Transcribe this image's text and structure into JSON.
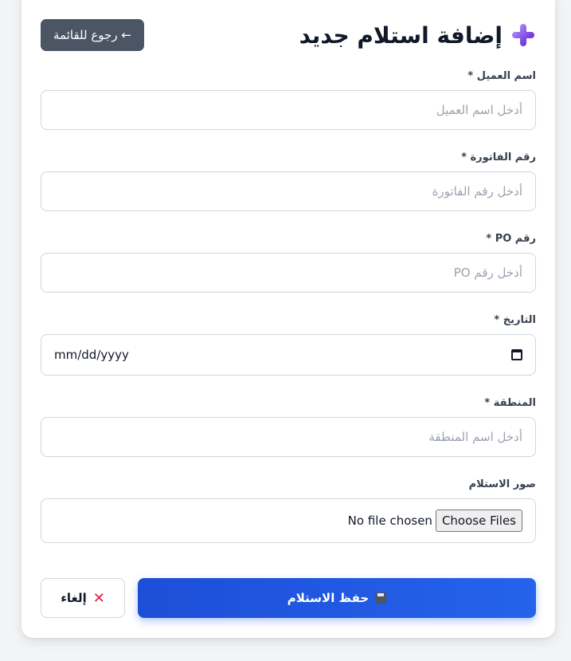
{
  "header": {
    "title": "إضافة استلام جديد",
    "back_label": "← رجوع للقائمة"
  },
  "form": {
    "customer": {
      "label": "اسم العميل *",
      "placeholder": "أدخل اسم العميل"
    },
    "invoice": {
      "label": "رقم الفاتورة *",
      "placeholder": "أدخل رقم الفاتورة"
    },
    "po": {
      "label": "رقم PO *",
      "placeholder": "أدخل رقم PO"
    },
    "date": {
      "label": "التاريخ *",
      "value": "mm/dd/yyyy"
    },
    "region": {
      "label": "المنطقة *",
      "placeholder": "أدخل اسم المنطقة"
    },
    "photos": {
      "label": "صور الاستلام",
      "button": "Choose Files",
      "status": "No file chosen"
    }
  },
  "actions": {
    "save_label": "حفظ الاستلام",
    "cancel_label": "إلغاء"
  },
  "colors": {
    "primary": "#2563eb",
    "back_button": "#4b5563",
    "cancel_icon": "#e11d48"
  },
  "icons": {
    "title": "plus-icon",
    "save": "floppy-disk-icon",
    "cancel": "x-icon",
    "date": "calendar-icon"
  }
}
